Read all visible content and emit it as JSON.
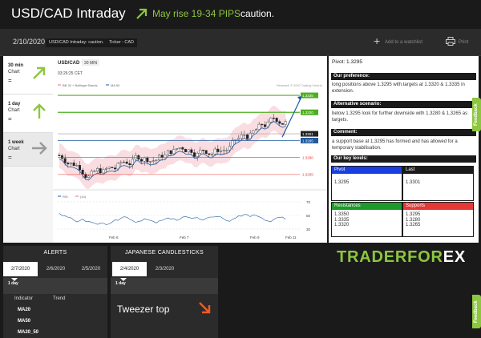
{
  "header": {
    "title": "USD/CAD Intraday",
    "headline": "May rise 19-34 PIPS",
    "caution": "caution.",
    "accent_color": "#8dc63f"
  },
  "topbar": {
    "date": "2/10/2020",
    "tag1": "USD/CAD Intraday: caution.",
    "tag2": "Ticker : CAD",
    "watchlist_label": "Add to a watchlist",
    "print_label": "Print"
  },
  "timeframes": [
    {
      "title": "30 min",
      "sub": "Chart",
      "eq": "=",
      "icon": "arrow-up-right-icon"
    },
    {
      "title": "1 day",
      "sub": "Chart",
      "eq": "=",
      "icon": "arrow-up-icon"
    },
    {
      "title": "1 week",
      "sub": "Chart",
      "eq": "=",
      "icon": "arrow-right-icon"
    }
  ],
  "chart": {
    "symbol": "USD/CAD",
    "interval": "30 MIN",
    "time": "03:26:25 CET",
    "legend1": "BB 20 + Bollinger Bands",
    "legend2": "MA 50",
    "credit": "Research © 2020 Trading Central",
    "levels": [
      "1.3335",
      "1.3320",
      "1.3301",
      "1.3295",
      "1.3280",
      "1.3265"
    ],
    "rsi_label1": "RSI",
    "rsi_label2": "(14)",
    "rsi_ticks": [
      "70",
      "50",
      "30"
    ],
    "dates": [
      "Feb 6",
      "Feb 7",
      "Feb 9",
      "Feb 11"
    ],
    "colors": {
      "up": "#2e9e3b",
      "down": "#c62828",
      "resist": "#4caf1f",
      "support": "#e53935"
    }
  },
  "analysis": {
    "pivot": "Pivot: 1.3295",
    "pref_head": "Our preference:",
    "pref_text": "long positions above 1.3295 with targets at 1.3320 & 1.3335 in extension.",
    "alt_head": "Alternative scenario:",
    "alt_text": "below 1.3295 look for further downside with 1.3280 & 1.3265 as targets.",
    "comment_head": "Comment:",
    "comment_text": "a support base at 1.3295 has formed and has allowed for a temporary stabilisation.",
    "levels_head": "Our key levels:",
    "pivot_label": "Pivot",
    "pivot_value": "1.3295",
    "last_label": "Last",
    "last_value": "1.3301",
    "resist_label": "Resistances",
    "resist_values": [
      "1.3350",
      "1.3335",
      "1.3320"
    ],
    "support_label": "Supports",
    "support_values": [
      "1.3295",
      "1.3280",
      "1.3265"
    ]
  },
  "feedback": "Feedback",
  "alerts": {
    "title": "ALERTS",
    "tabs": [
      "2/7/2020",
      "2/6/2020",
      "2/5/2020"
    ],
    "sub": "1 day",
    "col_indicator": "Indicator",
    "col_trend": "Trend",
    "rows": [
      "MA20",
      "MA50",
      "MA20_50"
    ]
  },
  "candles": {
    "title": "JAPANESE CANDLESTICKS",
    "tabs": [
      "2/4/2020",
      "2/3/2020"
    ],
    "sub": "1 day",
    "pattern": "Tweezer top"
  },
  "logo": {
    "part1": "TRADERFOR",
    "part2": "EX"
  }
}
